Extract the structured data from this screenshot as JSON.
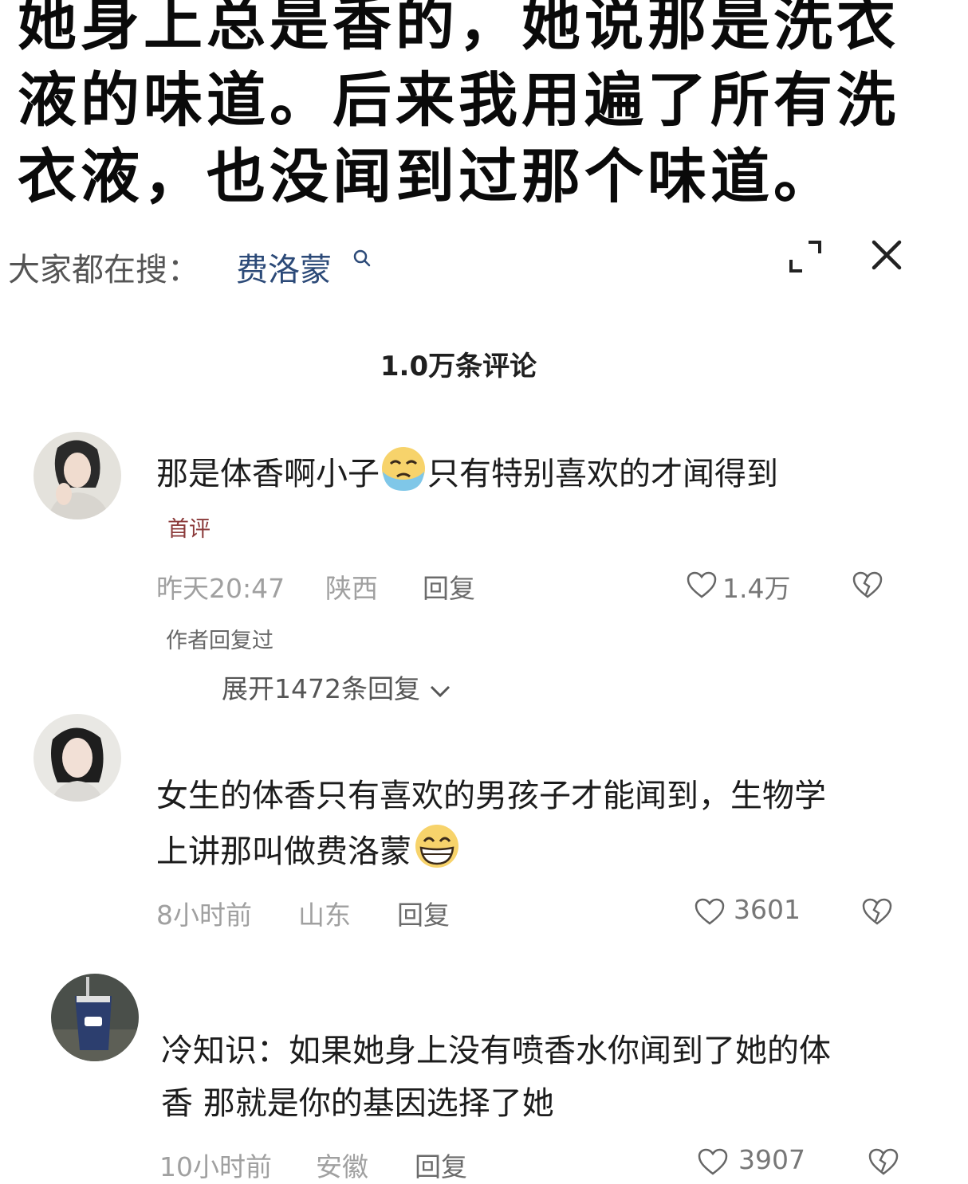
{
  "caption": "她身上总是香的，她说那是洗衣液的味道。后来我用遍了所有洗衣液，也没闻到过那个味道。",
  "search": {
    "prefix": "大家都在搜：",
    "term": "费洛蒙"
  },
  "header": {
    "comment_count": "1.0万条评论"
  },
  "comments": [
    {
      "text_a": "那是体香啊小子",
      "text_b": "只有特别喜欢的才闻得到",
      "badge": "首评",
      "time": "昨天20:47",
      "location": "陕西",
      "reply_label": "回复",
      "likes": "1.4万",
      "author_replied": "作者回复过",
      "expand_label": "展开1472条回复"
    },
    {
      "text_line1": "女生的体香只有喜欢的男孩子才能闻到，生物学",
      "text_line2": "上讲那叫做费洛蒙",
      "time": "8小时前",
      "location": "山东",
      "reply_label": "回复",
      "likes": "3601"
    },
    {
      "text_line1": "冷知识：如果她身上没有喷香水你闻到了她的体",
      "text_line2": "香 那就是你的基因选择了她",
      "time": "10小时前",
      "location": "安徽",
      "reply_label": "回复",
      "likes": "3907"
    }
  ],
  "icons": [
    "search-icon",
    "expand-icon",
    "close-icon",
    "heart-icon",
    "broken-heart-icon",
    "chevron-down-icon",
    "crying-emoji",
    "grinning-emoji"
  ]
}
